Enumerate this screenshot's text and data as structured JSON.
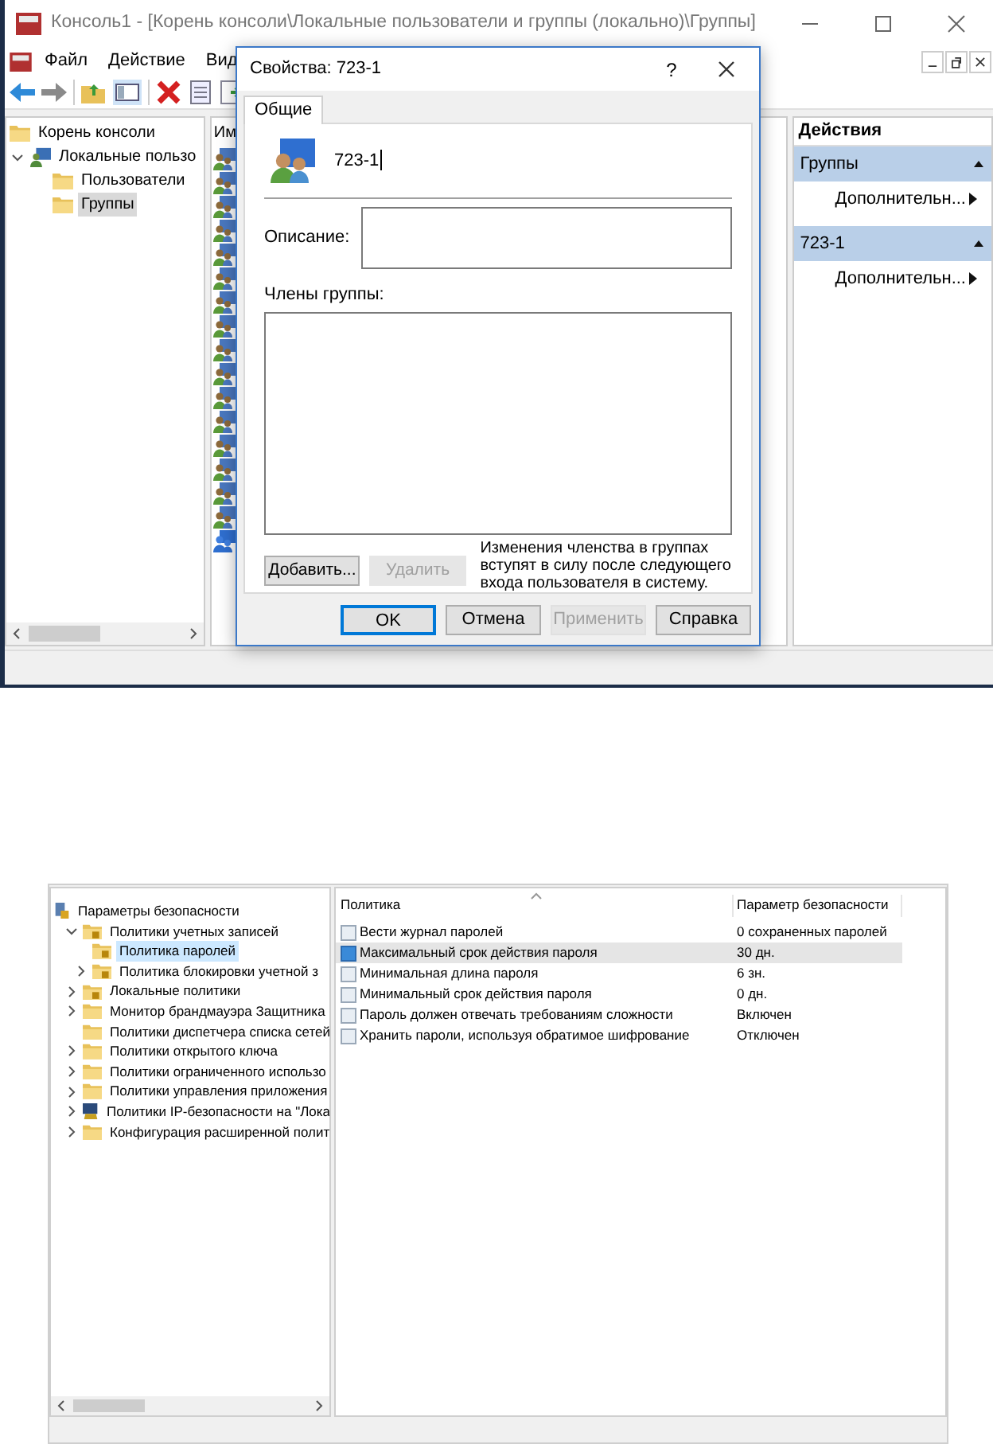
{
  "console": {
    "title": "Консоль1 - [Корень консоли\\Локальные пользователи и группы (локально)\\Группы]",
    "menu": [
      "Файл",
      "Действие",
      "Вид"
    ],
    "tree": [
      {
        "label": "Корень консоли",
        "kind": "folder",
        "selected": false
      },
      {
        "label": "Локальные пользо",
        "kind": "users",
        "expanded": true,
        "selected": false,
        "children": [
          {
            "label": "Пользователи",
            "kind": "folder",
            "selected": false
          },
          {
            "label": "Группы",
            "kind": "folder",
            "selected": true
          }
        ]
      }
    ],
    "list": {
      "column": "Им",
      "rows": [
        {
          "kind": "group"
        },
        {
          "kind": "group"
        },
        {
          "kind": "group"
        },
        {
          "kind": "group"
        },
        {
          "kind": "group"
        },
        {
          "kind": "group"
        },
        {
          "kind": "group"
        },
        {
          "kind": "group"
        },
        {
          "kind": "group"
        },
        {
          "kind": "group"
        },
        {
          "kind": "group"
        },
        {
          "kind": "group"
        },
        {
          "kind": "group"
        },
        {
          "kind": "group"
        },
        {
          "kind": "group"
        },
        {
          "kind": "group"
        },
        {
          "kind": "special"
        }
      ]
    },
    "actions": {
      "title": "Действия",
      "sections": [
        {
          "title": "Группы",
          "items": [
            "Дополнительн..."
          ]
        },
        {
          "title": "723-1",
          "items": [
            "Дополнительн..."
          ]
        }
      ]
    }
  },
  "dialog": {
    "title": "Свойства: 723-1",
    "help": "?",
    "tabs": [
      {
        "label": "Общие",
        "selected": true
      }
    ],
    "name": "723-1",
    "description_label": "Описание:",
    "members_label": "Члены группы:",
    "member_buttons": [
      {
        "label": "Добавить...",
        "disabled": false
      },
      {
        "label": "Удалить",
        "disabled": true
      }
    ],
    "note": "Изменения членства в группах вступят в силу после следующего входа пользователя в систему.",
    "buttons": [
      {
        "label": "OK",
        "disabled": false,
        "default": true
      },
      {
        "label": "Отмена",
        "disabled": false,
        "default": false
      },
      {
        "label": "Применить",
        "disabled": true,
        "default": false
      },
      {
        "label": "Справка",
        "disabled": false,
        "default": false
      }
    ]
  },
  "security": {
    "tree": [
      {
        "label": "Параметры безопасности",
        "kind": "root",
        "selected": false,
        "children": [
          {
            "label": "Политики учетных записей",
            "kind": "lock-folder",
            "expanded": true,
            "selected": false,
            "children": [
              {
                "label": "Политика паролей",
                "kind": "lock-folder",
                "selected": true
              },
              {
                "label": "Политика блокировки учетной з",
                "kind": "lock-folder",
                "expanded": false,
                "selected": false
              }
            ]
          },
          {
            "label": "Локальные политики",
            "kind": "lock-folder",
            "expanded": false,
            "selected": false
          },
          {
            "label": "Монитор брандмауэра Защитника",
            "kind": "folder",
            "expanded": false,
            "selected": false
          },
          {
            "label": "Политики диспетчера списка сетей",
            "kind": "folder",
            "selected": false
          },
          {
            "label": "Политики открытого ключа",
            "kind": "folder",
            "expanded": false,
            "selected": false
          },
          {
            "label": "Политики ограниченного использо",
            "kind": "folder",
            "expanded": false,
            "selected": false
          },
          {
            "label": "Политики управления приложения",
            "kind": "folder",
            "expanded": false,
            "selected": false
          },
          {
            "label": "Политики IP-безопасности на \"Лока",
            "kind": "ip",
            "expanded": false,
            "selected": false
          },
          {
            "label": "Конфигурация расширенной полит",
            "kind": "folder",
            "expanded": false,
            "selected": false
          }
        ]
      }
    ],
    "table": {
      "columns": [
        "Политика",
        "Параметр безопасности"
      ],
      "rows": [
        {
          "policy": "Вести журнал паролей",
          "value": "0 сохраненных паролей",
          "selected": false
        },
        {
          "policy": "Максимальный срок действия пароля",
          "value": "30 дн.",
          "selected": true
        },
        {
          "policy": "Минимальная длина пароля",
          "value": "6 зн.",
          "selected": false
        },
        {
          "policy": "Минимальный срок действия пароля",
          "value": "0 дн.",
          "selected": false
        },
        {
          "policy": "Пароль должен отвечать требованиям сложности",
          "value": "Включен",
          "selected": false
        },
        {
          "policy": "Хранить пароли, используя обратимое шифрование",
          "value": "Отключен",
          "selected": false
        }
      ]
    }
  }
}
